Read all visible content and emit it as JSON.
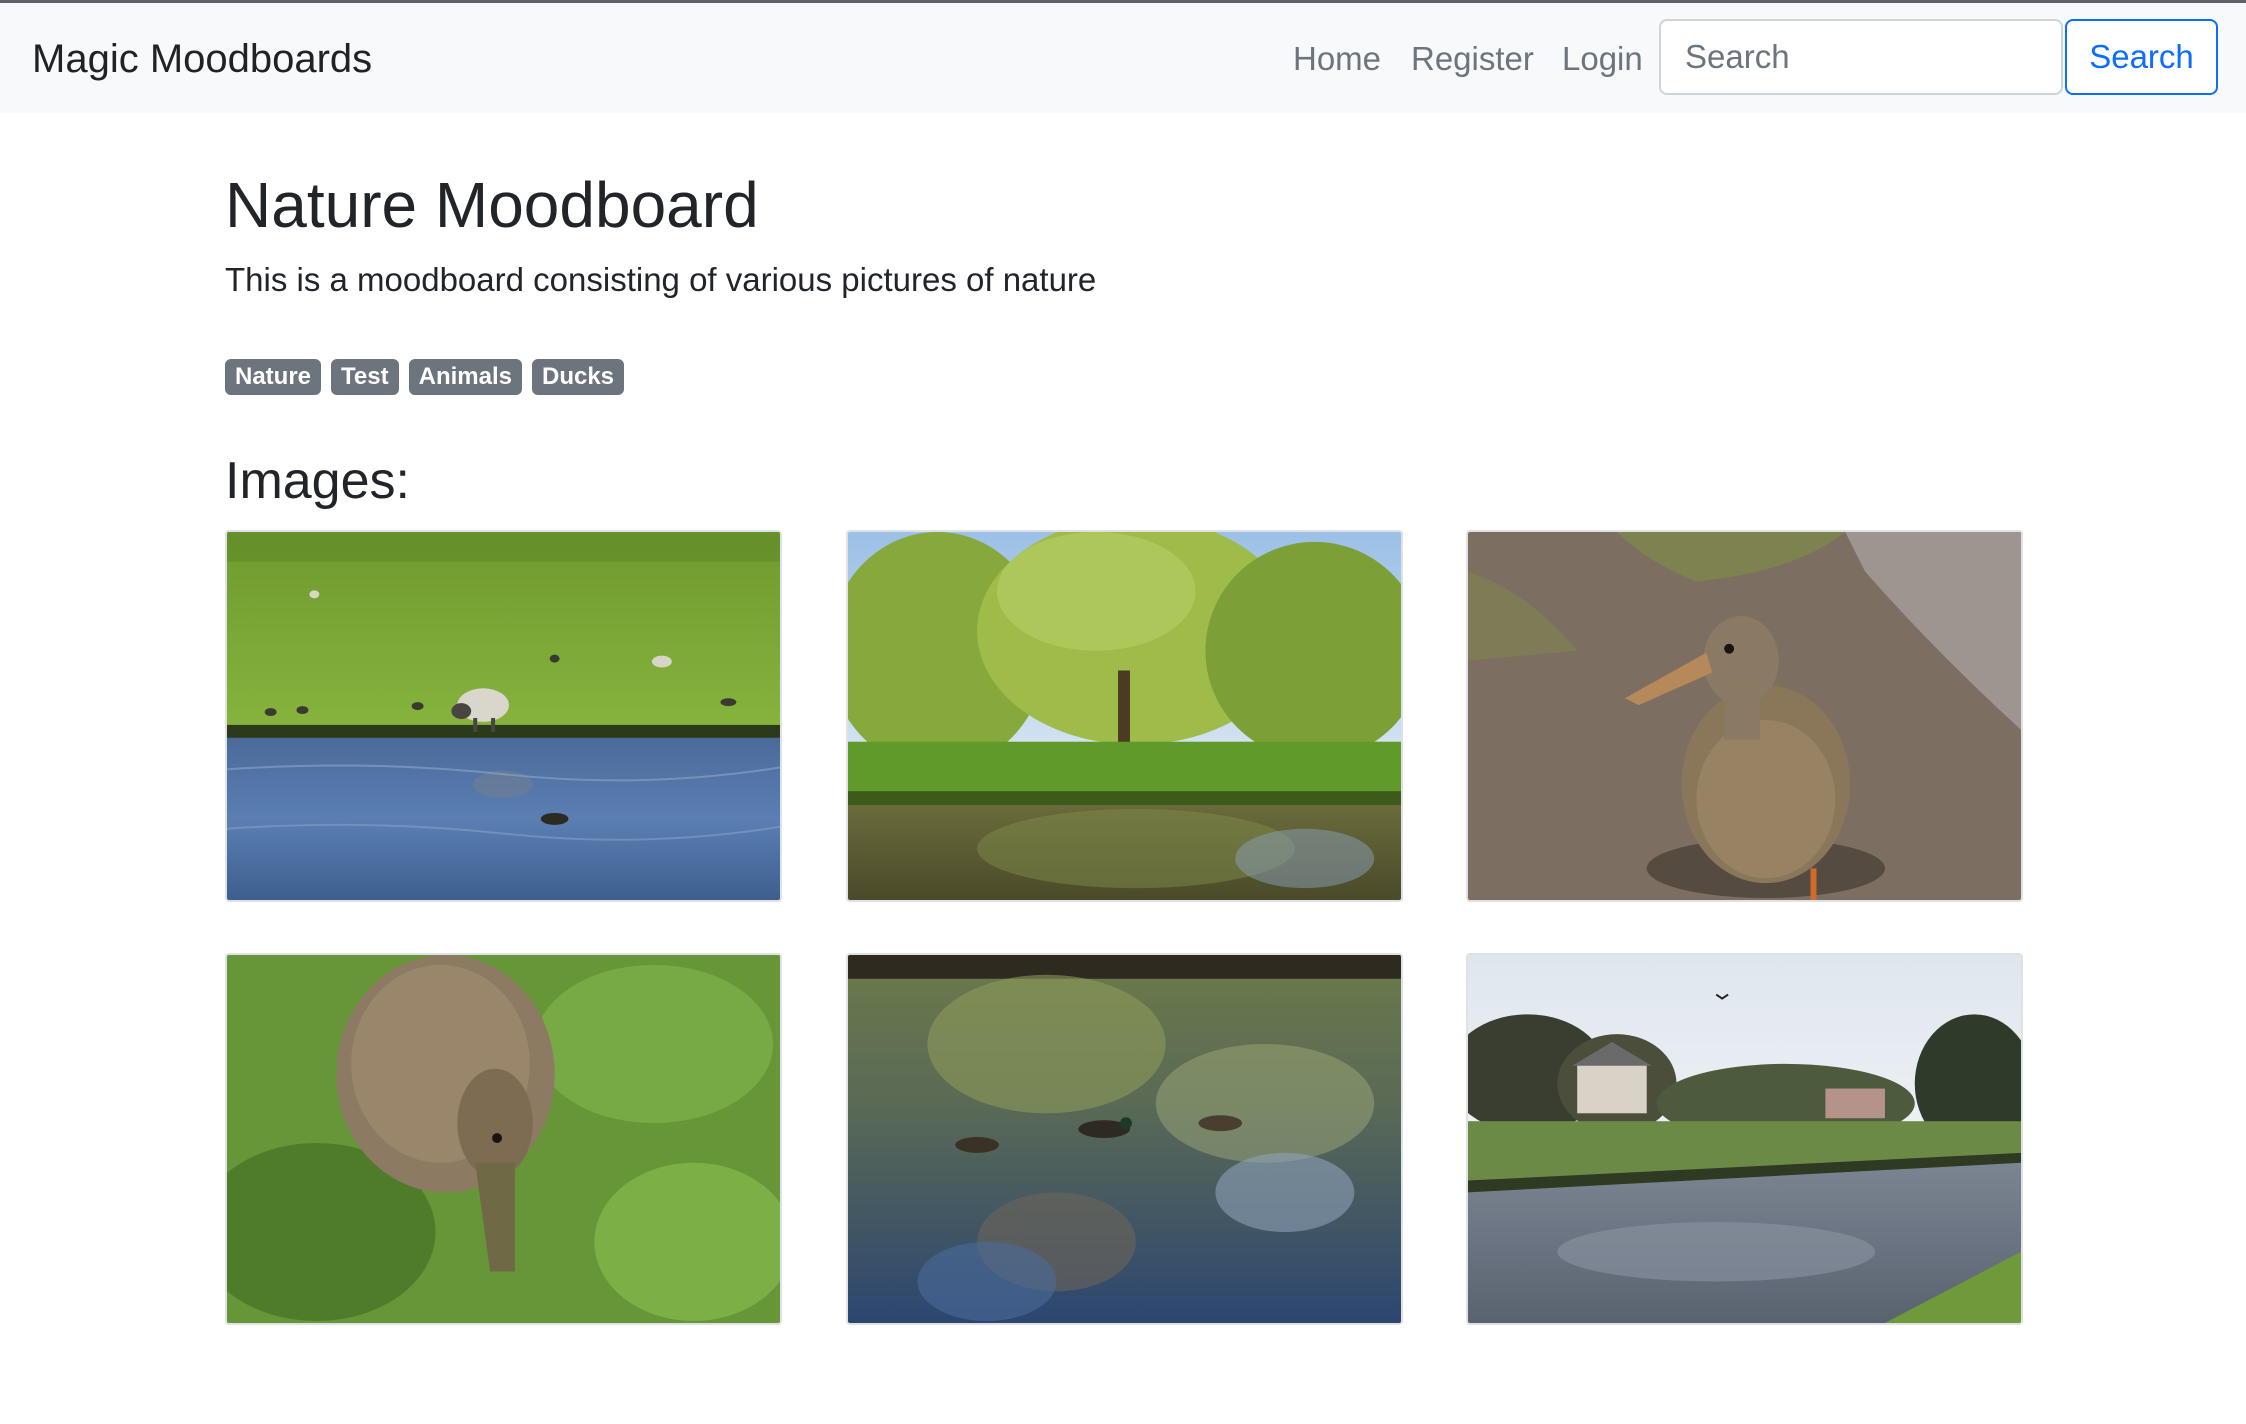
{
  "navbar": {
    "brand": "Magic Moodboards",
    "links": [
      "Home",
      "Register",
      "Login"
    ],
    "search_placeholder": "Search",
    "search_button": "Search"
  },
  "moodboard": {
    "title": "Nature Moodboard",
    "description": "This is a moodboard consisting of various pictures of nature",
    "tags": [
      "Nature",
      "Test",
      "Animals",
      "Ducks"
    ]
  },
  "images_heading": "Images:",
  "colors": {
    "navbar_bg": "#f8f9fa",
    "link_muted": "#6c757d",
    "primary": "#0d6efd",
    "badge_bg": "#6c757d"
  }
}
